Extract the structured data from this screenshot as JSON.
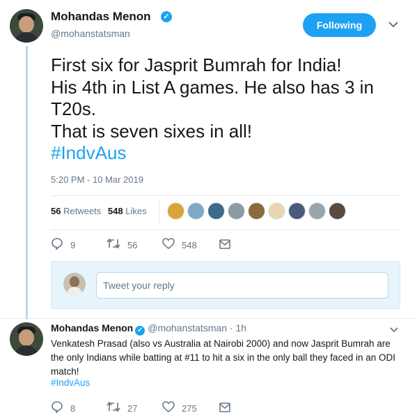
{
  "tweet": {
    "author_name": "Mohandas Menon",
    "author_handle": "@mohanstatsman",
    "follow_label": "Following",
    "text_lines": [
      "First six for Jasprit Bumrah for India!",
      "His 4th in List A games. He also has 3 in",
      "T20s.",
      "That is seven sixes in all!"
    ],
    "hashtag": "#IndvAus",
    "timestamp": "5:20 PM - 10 Mar 2019",
    "retweets_count": "56",
    "retweets_label": "Retweets",
    "likes_count": "548",
    "likes_label": "Likes",
    "liker_colors": [
      "#d9a53a",
      "#7fa9c4",
      "#3f6b8a",
      "#8c9aa3",
      "#8a6a3c",
      "#e8d6b3",
      "#4a5a7c",
      "#9aa5ad",
      "#5b4a3e"
    ],
    "actions": {
      "replies": "9",
      "retweets": "56",
      "likes": "548"
    }
  },
  "reply_box": {
    "placeholder": "Tweet your reply"
  },
  "reply_tweet": {
    "author_name": "Mohandas Menon",
    "author_handle": "@mohanstatsman",
    "separator": "·",
    "time": "1h",
    "text": "Venkatesh Prasad (also vs Australia at Nairobi 2000) and now Jasprit Bumrah are the only Indians while batting at #11 to hit a six in the only ball they faced in an ODI match!",
    "hashtag": "#IndvAus",
    "actions": {
      "replies": "8",
      "retweets": "27",
      "likes": "275"
    }
  },
  "colors": {
    "accent": "#1da1f2",
    "secondary_text": "#657786",
    "thread_line": "#b9d6ea",
    "reply_box_bg": "#e8f4fb"
  }
}
